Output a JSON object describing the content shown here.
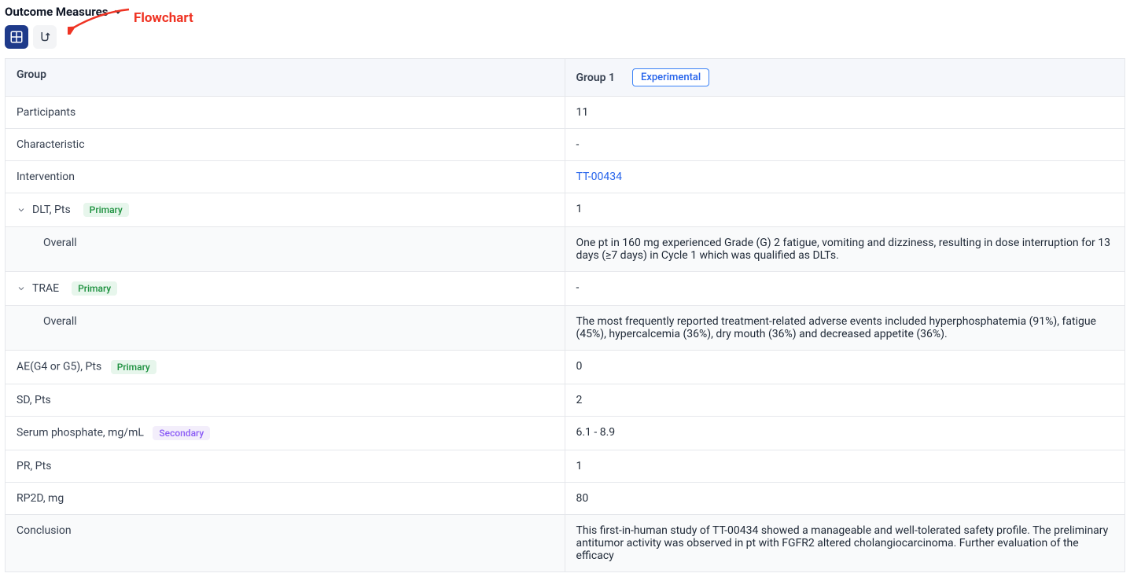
{
  "section_title": "Outcome Measures",
  "annotation_label": "Flowchart",
  "header": {
    "group_label": "Group",
    "group1_label": "Group 1",
    "group1_badge": "Experimental"
  },
  "badges": {
    "primary": "Primary",
    "secondary": "Secondary"
  },
  "rows": {
    "participants": {
      "label": "Participants",
      "value": "11"
    },
    "characteristic": {
      "label": "Characteristic",
      "value": "-"
    },
    "intervention": {
      "label": "Intervention",
      "value": "TT-00434"
    },
    "dlt": {
      "label": "DLT, Pts",
      "value": "1"
    },
    "dlt_overall": {
      "label": "Overall",
      "value": "One pt in 160 mg experienced Grade (G) 2 fatigue, vomiting and dizziness, resulting in dose interruption for 13 days (≥7 days) in Cycle 1 which was qualified as DLTs."
    },
    "trae": {
      "label": "TRAE",
      "value": "-"
    },
    "trae_overall": {
      "label": "Overall",
      "value": "The most frequently reported treatment-related adverse events included hyperphosphatemia (91%), fatigue (45%), hypercalcemia (36%), dry mouth (36%) and decreased appetite (36%)."
    },
    "ae_g45": {
      "label": "AE(G4 or G5), Pts",
      "value": "0"
    },
    "sd": {
      "label": "SD, Pts",
      "value": "2"
    },
    "phosphate": {
      "label": "Serum phosphate, mg/mL",
      "value": "6.1 - 8.9"
    },
    "pr": {
      "label": "PR, Pts",
      "value": "1"
    },
    "rp2d": {
      "label": "RP2D, mg",
      "value": "80"
    },
    "conclusion": {
      "label": "Conclusion",
      "value": "This first-in-human study of TT-00434 showed a manageable and well-tolerated safety profile. The preliminary antitumor activity was observed in pt with FGFR2 altered cholangiocarcinoma. Further evaluation of the efficacy"
    }
  }
}
